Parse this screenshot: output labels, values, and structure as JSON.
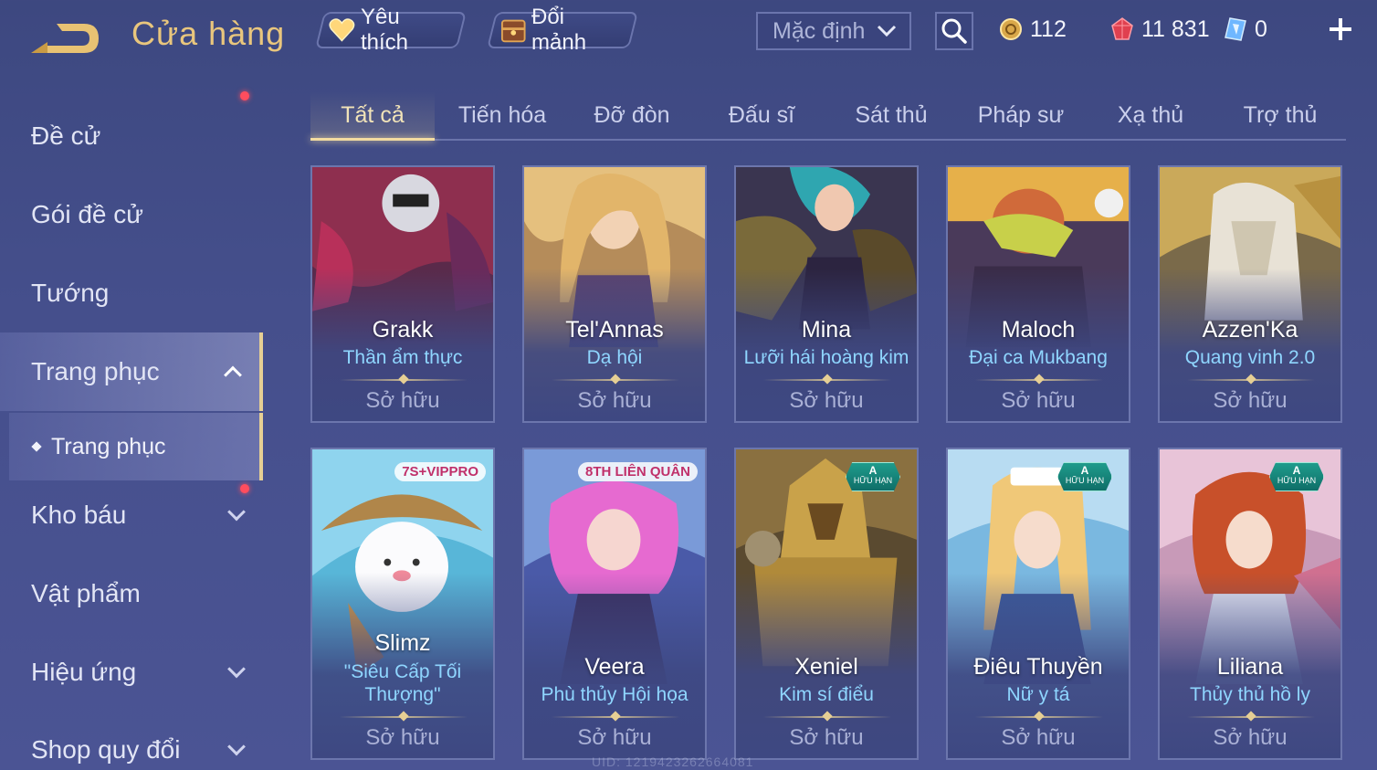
{
  "header": {
    "title": "Cửa hàng",
    "favorite_label": "Yêu thích",
    "exchange_label": "Đổi mảnh",
    "sort_value": "Mặc định",
    "currencies": {
      "gold": "112",
      "ruby": "11 831",
      "token": "0"
    }
  },
  "sidebar": {
    "items": [
      {
        "label": "Đề cử"
      },
      {
        "label": "Gói đề cử"
      },
      {
        "label": "Tướng"
      },
      {
        "label": "Trang phục"
      },
      {
        "label": "Kho báu"
      },
      {
        "label": "Vật phẩm"
      },
      {
        "label": "Hiệu ứng"
      },
      {
        "label": "Shop quy đổi"
      }
    ],
    "sub_item": "Trang phục"
  },
  "tabs": [
    "Tất cả",
    "Tiến hóa",
    "Đỡ đòn",
    "Đấu sĩ",
    "Sát thủ",
    "Pháp sư",
    "Xạ thủ",
    "Trợ thủ"
  ],
  "cards": [
    {
      "hero": "Grakk",
      "skin": "Thần ẩm thực",
      "status": "Sở hữu"
    },
    {
      "hero": "Tel'Annas",
      "skin": "Dạ hội",
      "status": "Sở hữu"
    },
    {
      "hero": "Mina",
      "skin": "Lưỡi hái hoàng kim",
      "status": "Sở hữu"
    },
    {
      "hero": "Maloch",
      "skin": "Đại ca Mukbang",
      "status": "Sở hữu"
    },
    {
      "hero": "Azzen'Ka",
      "skin": "Quang vinh 2.0",
      "status": "Sở hữu"
    },
    {
      "hero": "Slimz",
      "skin": "\"Siêu Cấp Tối Thượng\"",
      "status": "Sở hữu",
      "tag": "7S+VIPPRO"
    },
    {
      "hero": "Veera",
      "skin": "Phù thủy Hội họa",
      "status": "Sở hữu",
      "tag": "8TH LIÊN QUÂN"
    },
    {
      "hero": "Xeniel",
      "skin": "Kim sí điểu",
      "status": "Sở hữu",
      "badge_top": "A",
      "badge_bottom": "HỮU HẠN"
    },
    {
      "hero": "Điêu Thuyền",
      "skin": "Nữ y tá",
      "status": "Sở hữu",
      "badge_top": "A",
      "badge_bottom": "HỮU HẠN"
    },
    {
      "hero": "Liliana",
      "skin": "Thủy thủ hồ ly",
      "status": "Sở hữu",
      "badge_top": "A",
      "badge_bottom": "HỮU HẠN"
    }
  ],
  "footer": {
    "uid": "UID: 1219423262664081"
  }
}
